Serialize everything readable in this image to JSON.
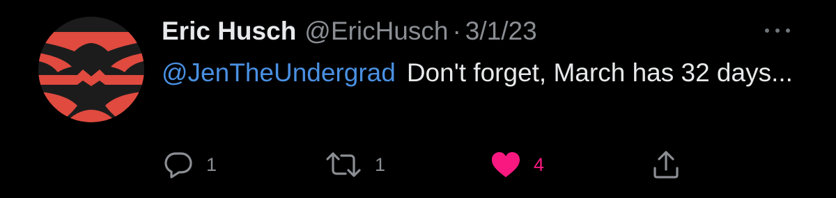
{
  "tweet": {
    "author": {
      "display_name": "Eric Husch",
      "handle": "@EricHusch"
    },
    "separator": "·",
    "date": "3/1/23",
    "mention": "@JenTheUndergrad",
    "text": "Don't forget, March has 32 days...",
    "actions": {
      "reply": {
        "icon": "reply-icon",
        "count": "1"
      },
      "retweet": {
        "icon": "retweet-icon",
        "count": "1"
      },
      "like": {
        "icon": "heart-icon",
        "count": "4",
        "liked": true
      },
      "share": {
        "icon": "share-icon"
      }
    }
  },
  "colors": {
    "background": "#000000",
    "text_primary": "#e7e9ea",
    "text_secondary": "#8b8f94",
    "mention": "#4a90e2",
    "like": "#f91880",
    "avatar_red": "#e04a3f",
    "avatar_dark": "#1c1c1c"
  }
}
